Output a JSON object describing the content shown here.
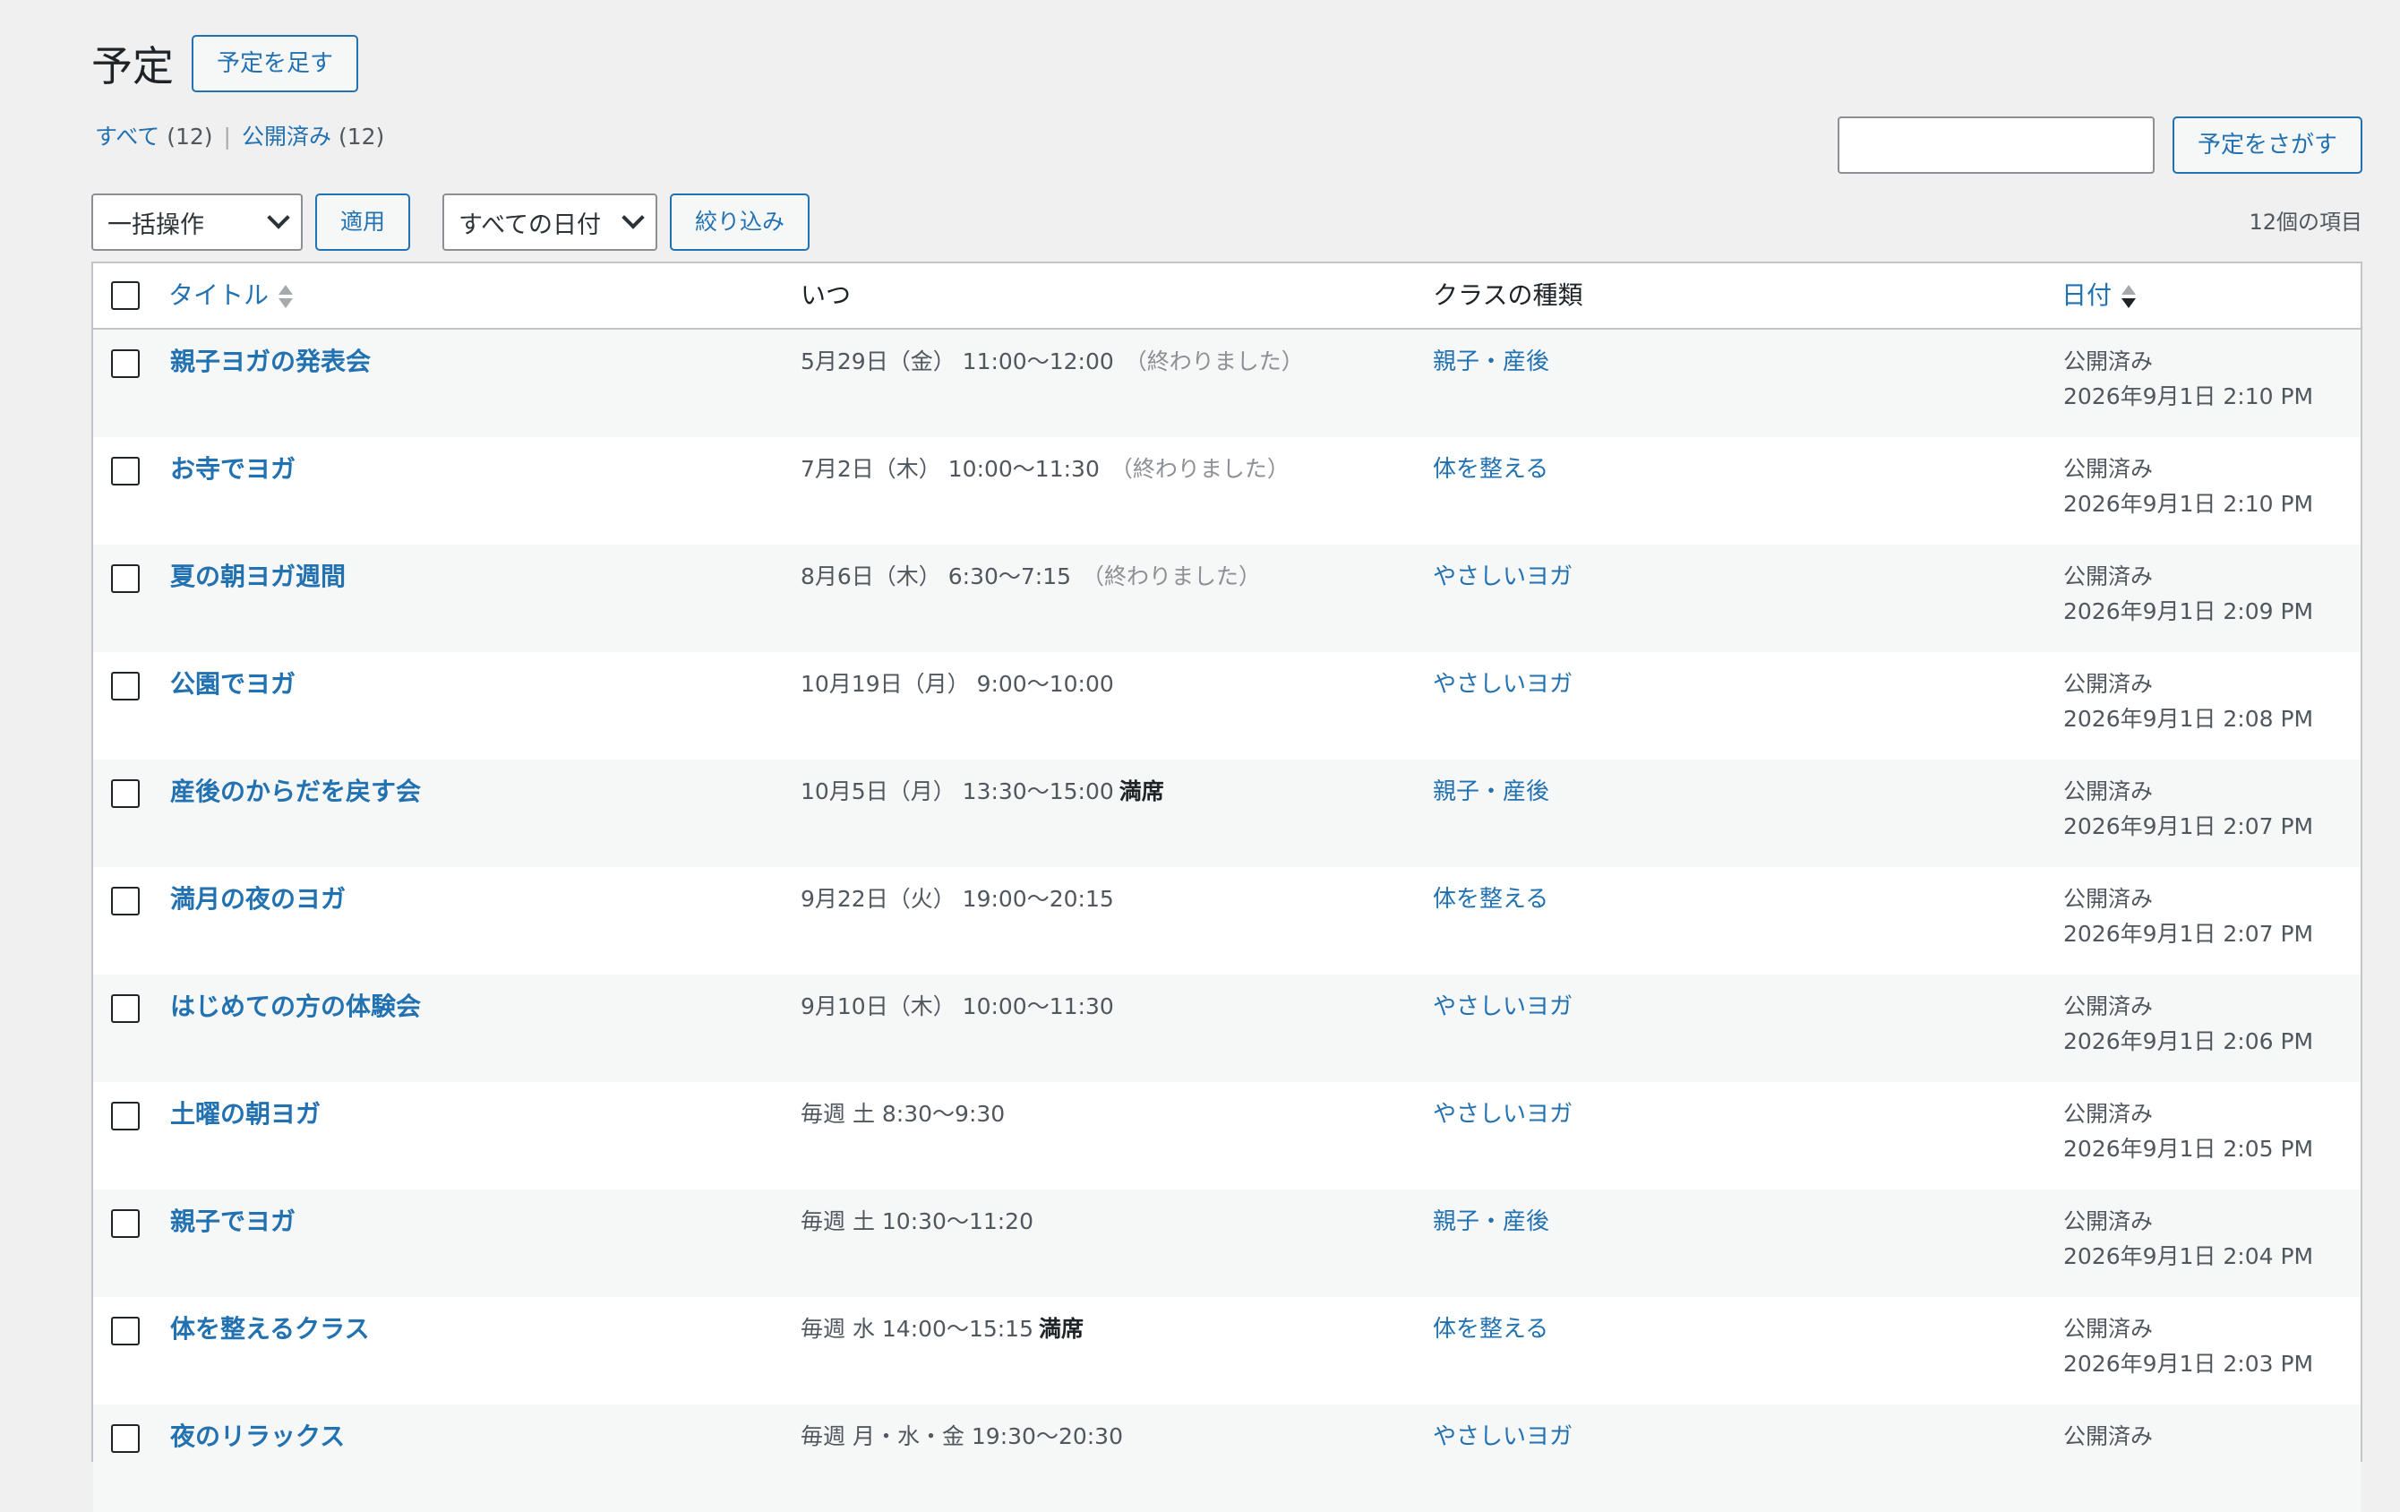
{
  "header": {
    "title": "予定",
    "add_button": "予定を足す"
  },
  "filters": {
    "all_label": "すべて",
    "all_count": "(12)",
    "separator": "|",
    "published_label": "公開済み",
    "published_count": "(12)"
  },
  "search": {
    "input_value": "",
    "button": "予定をさがす"
  },
  "tablenav": {
    "bulk_action": "一括操作",
    "apply": "適用",
    "date_filter": "すべての日付",
    "filter_button": "絞り込み",
    "items_count": "12個の項目"
  },
  "columns": {
    "title": "タイトル",
    "when": "いつ",
    "class_type": "クラスの種類",
    "date": "日付"
  },
  "rows": [
    {
      "title": "親子ヨガの発表会",
      "when": "5月29日（金） 11:00〜12:00",
      "note": "（終わりました）",
      "note_type": "ended",
      "class_type": "親子・産後",
      "status": "公開済み",
      "date": "2026年9月1日 2:10 PM"
    },
    {
      "title": "お寺でヨガ",
      "when": "7月2日（木） 10:00〜11:30",
      "note": "（終わりました）",
      "note_type": "ended",
      "class_type": "体を整える",
      "status": "公開済み",
      "date": "2026年9月1日 2:10 PM"
    },
    {
      "title": "夏の朝ヨガ週間",
      "when": "8月6日（木） 6:30〜7:15",
      "note": "（終わりました）",
      "note_type": "ended",
      "class_type": "やさしいヨガ",
      "status": "公開済み",
      "date": "2026年9月1日 2:09 PM"
    },
    {
      "title": "公園でヨガ",
      "when": "10月19日（月） 9:00〜10:00",
      "note": "",
      "note_type": "",
      "class_type": "やさしいヨガ",
      "status": "公開済み",
      "date": "2026年9月1日 2:08 PM"
    },
    {
      "title": "産後のからだを戻す会",
      "when": "10月5日（月） 13:30〜15:00",
      "note": "満席",
      "note_type": "full",
      "class_type": "親子・産後",
      "status": "公開済み",
      "date": "2026年9月1日 2:07 PM"
    },
    {
      "title": "満月の夜のヨガ",
      "when": "9月22日（火） 19:00〜20:15",
      "note": "",
      "note_type": "",
      "class_type": "体を整える",
      "status": "公開済み",
      "date": "2026年9月1日 2:07 PM"
    },
    {
      "title": "はじめての方の体験会",
      "when": "9月10日（木） 10:00〜11:30",
      "note": "",
      "note_type": "",
      "class_type": "やさしいヨガ",
      "status": "公開済み",
      "date": "2026年9月1日 2:06 PM"
    },
    {
      "title": "土曜の朝ヨガ",
      "when": "毎週 土 8:30〜9:30",
      "note": "",
      "note_type": "",
      "class_type": "やさしいヨガ",
      "status": "公開済み",
      "date": "2026年9月1日 2:05 PM"
    },
    {
      "title": "親子でヨガ",
      "when": "毎週 土 10:30〜11:20",
      "note": "",
      "note_type": "",
      "class_type": "親子・産後",
      "status": "公開済み",
      "date": "2026年9月1日 2:04 PM"
    },
    {
      "title": "体を整えるクラス",
      "when": "毎週 水 14:00〜15:15",
      "note": "満席",
      "note_type": "full",
      "class_type": "体を整える",
      "status": "公開済み",
      "date": "2026年9月1日 2:03 PM"
    },
    {
      "title": "夜のリラックス",
      "when": "毎週 月・水・金 19:30〜20:30",
      "note": "",
      "note_type": "",
      "class_type": "やさしいヨガ",
      "status": "公開済み",
      "date": ""
    }
  ]
}
